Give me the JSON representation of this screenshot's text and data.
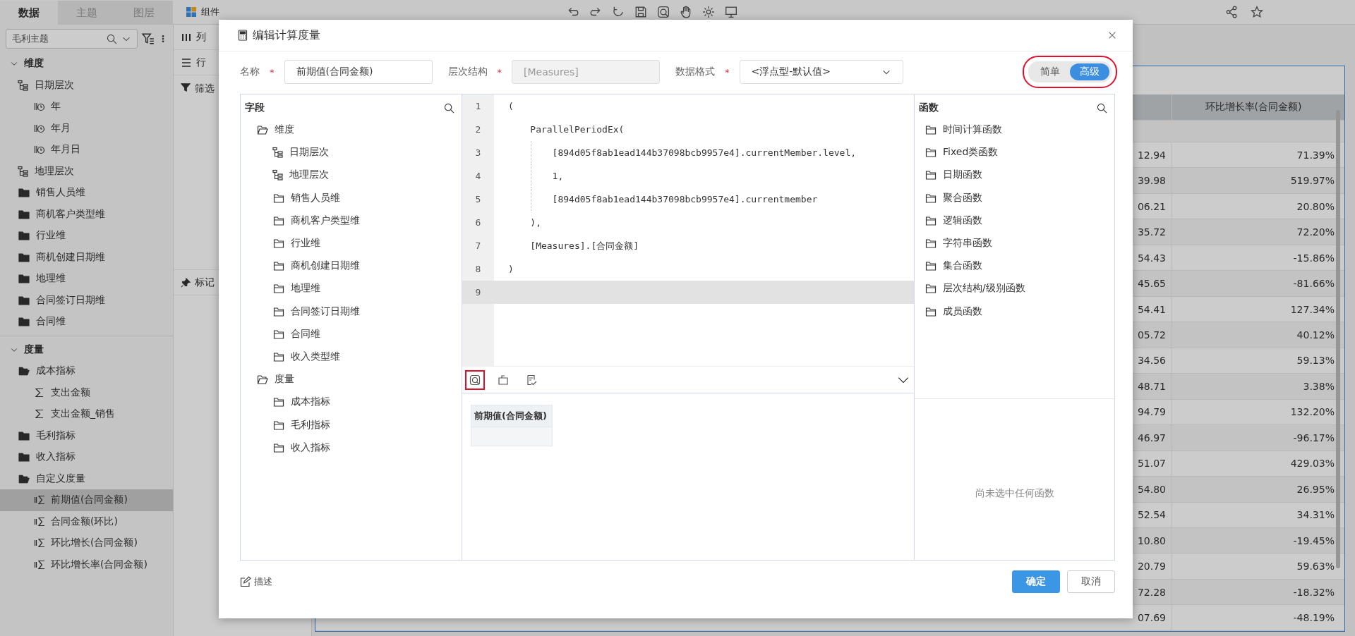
{
  "sidebar": {
    "tabs": [
      {
        "label": "数据",
        "selected": true
      },
      {
        "label": "主题",
        "selected": false
      },
      {
        "label": "图层",
        "selected": false
      }
    ],
    "subject_select": {
      "value": "毛利主题"
    },
    "tree": [
      {
        "label": "维度",
        "kind": "group",
        "expanded": true,
        "children": [
          {
            "label": "日期层次",
            "kind": "hierarchy",
            "children": [
              {
                "label": "年",
                "kind": "level"
              },
              {
                "label": "年月",
                "kind": "level"
              },
              {
                "label": "年月日",
                "kind": "level"
              }
            ]
          },
          {
            "label": "地理层次",
            "kind": "hierarchy"
          },
          {
            "label": "销售人员维",
            "kind": "folder",
            "expanded": false
          },
          {
            "label": "商机客户类型维",
            "kind": "folder",
            "expanded": false
          },
          {
            "label": "行业维",
            "kind": "folder",
            "expanded": false
          },
          {
            "label": "商机创建日期维",
            "kind": "folder",
            "expanded": false
          },
          {
            "label": "地理维",
            "kind": "folder",
            "expanded": false
          },
          {
            "label": "合同签订日期维",
            "kind": "folder",
            "expanded": false
          },
          {
            "label": "合同维",
            "kind": "folder",
            "expanded": false
          }
        ]
      },
      {
        "label": "度量",
        "kind": "group",
        "expanded": true,
        "children": [
          {
            "label": "成本指标",
            "kind": "folder",
            "expanded": true,
            "children": [
              {
                "label": "支出金额",
                "kind": "measure"
              },
              {
                "label": "支出金额_销售",
                "kind": "measure"
              }
            ]
          },
          {
            "label": "毛利指标",
            "kind": "folder",
            "expanded": false
          },
          {
            "label": "收入指标",
            "kind": "folder",
            "expanded": false
          },
          {
            "label": "自定义度量",
            "kind": "folder",
            "expanded": true,
            "children": [
              {
                "label": "前期值(合同金额)",
                "kind": "calc_measure",
                "selected": true
              },
              {
                "label": "合同金额(环比)",
                "kind": "calc_measure",
                "selected": false
              },
              {
                "label": "环比增长(合同金额)",
                "kind": "calc_measure",
                "selected": false
              },
              {
                "label": "环比增长率(合同金额)",
                "kind": "calc_measure",
                "selected": false
              }
            ]
          }
        ]
      }
    ]
  },
  "shelves": [
    {
      "label": "列",
      "kind": "columns"
    },
    {
      "label": "行",
      "kind": "rows"
    },
    {
      "label": "筛选",
      "kind": "filter"
    },
    {
      "label": "标记",
      "kind": "marks"
    }
  ],
  "toolbar": {
    "component_label": "组件"
  },
  "table": {
    "header": "环比增长率(合同金额)",
    "rows": [
      [
        "12.94",
        "71.39%"
      ],
      [
        "39.98",
        "519.97%"
      ],
      [
        "06.21",
        "20.80%"
      ],
      [
        "35.72",
        "72.20%"
      ],
      [
        "54.43",
        "-15.86%"
      ],
      [
        "45.65",
        "-81.66%"
      ],
      [
        "54.41",
        "127.34%"
      ],
      [
        "05.72",
        "40.12%"
      ],
      [
        "34.56",
        "59.13%"
      ],
      [
        "48.71",
        "3.38%"
      ],
      [
        "94.79",
        "132.20%"
      ],
      [
        "46.97",
        "-96.17%"
      ],
      [
        "51.07",
        "429.03%"
      ],
      [
        "54.80",
        "26.95%"
      ],
      [
        "52.54",
        "34.31%"
      ],
      [
        "10.80",
        "-19.45%"
      ],
      [
        "20.79",
        "59.63%"
      ],
      [
        "72.28",
        "-18.32%"
      ],
      [
        "07.69",
        "-48.19%"
      ]
    ]
  },
  "dialog": {
    "title": "编辑计算度量",
    "fields": [
      {
        "label": "名称",
        "required_mark": "*",
        "kind": "input",
        "value": "前期值(合同金额)"
      },
      {
        "label": "层次结构",
        "required_mark": "*",
        "kind": "disabled",
        "value": "[Measures]"
      },
      {
        "label": "数据格式",
        "required_mark": "*",
        "kind": "select",
        "value": "<浮点型-默认值>"
      }
    ],
    "mode_toggle": {
      "highlighted": true,
      "options": [
        {
          "label": "简单",
          "selected": false
        },
        {
          "label": "高级",
          "selected": true
        }
      ]
    },
    "fields_panel": {
      "title": "字段",
      "tree": [
        {
          "label": "维度",
          "kind": "folder",
          "expanded": true,
          "children": [
            {
              "label": "日期层次",
              "kind": "hierarchy"
            },
            {
              "label": "地理层次",
              "kind": "hierarchy"
            },
            {
              "label": "销售人员维",
              "kind": "folder",
              "expanded": false
            },
            {
              "label": "商机客户类型维",
              "kind": "folder",
              "expanded": false
            },
            {
              "label": "行业维",
              "kind": "folder",
              "expanded": false
            },
            {
              "label": "商机创建日期维",
              "kind": "folder",
              "expanded": false
            },
            {
              "label": "地理维",
              "kind": "folder",
              "expanded": false
            },
            {
              "label": "合同签订日期维",
              "kind": "folder",
              "expanded": false
            },
            {
              "label": "合同维",
              "kind": "folder",
              "expanded": false
            },
            {
              "label": "收入类型维",
              "kind": "folder",
              "expanded": false
            }
          ]
        },
        {
          "label": "度量",
          "kind": "folder",
          "expanded": true,
          "children": [
            {
              "label": "成本指标",
              "kind": "folder",
              "expanded": false
            },
            {
              "label": "毛利指标",
              "kind": "folder",
              "expanded": false
            },
            {
              "label": "收入指标",
              "kind": "folder",
              "expanded": false
            }
          ]
        }
      ]
    },
    "editor": {
      "lines": [
        {
          "number": "1",
          "code": "(",
          "current": false
        },
        {
          "number": "2",
          "code": "    ParallelPeriodEx(",
          "current": false
        },
        {
          "number": "3",
          "code": "        [894d05f8ab1ead144b37098bcb9957e4].currentMember.level,",
          "current": false
        },
        {
          "number": "4",
          "code": "        1,",
          "current": false
        },
        {
          "number": "5",
          "code": "        [894d05f8ab1ead144b37098bcb9957e4].currentmember",
          "current": false
        },
        {
          "number": "6",
          "code": "    ),",
          "current": false
        },
        {
          "number": "7",
          "code": "    [Measures].[合同金额]",
          "current": false
        },
        {
          "number": "8",
          "code": ")",
          "current": false
        },
        {
          "number": "9",
          "current": true
        }
      ],
      "tools": [
        {
          "kind": "preview",
          "highlighted": true
        },
        {
          "kind": "insert",
          "highlighted": false
        },
        {
          "kind": "check",
          "highlighted": false
        }
      ]
    },
    "preview": {
      "header": "前期值(合同金额)"
    },
    "functions_panel": {
      "title": "函数",
      "items": [
        "时间计算函数",
        "Fixed类函数",
        "日期函数",
        "聚合函数",
        "逻辑函数",
        "字符串函数",
        "集合函数",
        "层次结构/级别函数",
        "成员函数"
      ],
      "empty_hint": "尚未选中任何函数"
    },
    "describe_link": "描述",
    "buttons": [
      {
        "label": "确定",
        "kind": "primary"
      },
      {
        "label": "取消",
        "kind": "secondary"
      }
    ]
  }
}
